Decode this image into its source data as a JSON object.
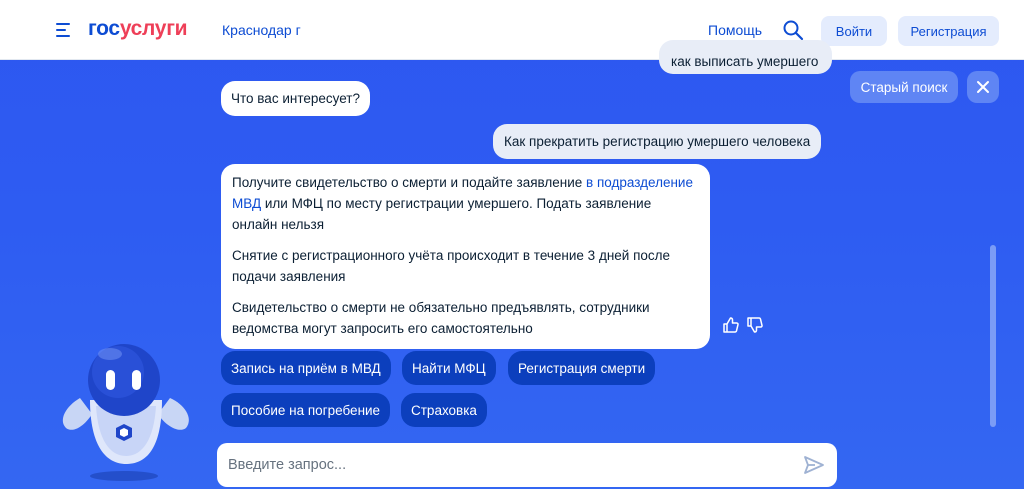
{
  "header": {
    "logo_part1": "гос",
    "logo_part2": "услуги",
    "city": "Краснодар г",
    "help": "Помощь",
    "login": "Войти",
    "register": "Регистрация"
  },
  "chat": {
    "hidden_message": "как выписать умершего",
    "old_search": "Старый поиск",
    "bot_question": "Что вас интересует?",
    "user_message": "Как прекратить регистрацию умершего человека",
    "answer": {
      "p1_before_link": "Получите свидетельство о смерти и подайте заявление ",
      "p1_link": "в подразделение МВД",
      "p1_after_link": " или МФЦ по месту регистрации умершего. Подать заявление онлайн нельзя",
      "p2": "Снятие с регистрационного учёта происходит в течение 3 дней после подачи заявления",
      "p3": "Свидетельство о смерти не обязательно предъявлять, сотрудники ведомства могут запросить его самостоятельно"
    },
    "chips": [
      "Запись на приём в МВД",
      "Найти МФЦ",
      "Регистрация смерти",
      "Пособие на погребение",
      "Страховка"
    ],
    "input_placeholder": "Введите запрос..."
  },
  "colors": {
    "brand_blue": "#0d4cd3",
    "brand_red": "#ee3f58",
    "background": "#2e5cf2",
    "chip": "#0c3fbd"
  },
  "icons": [
    "menu-icon",
    "search-icon",
    "close-icon",
    "thumbs-up-icon",
    "thumbs-down-icon",
    "send-icon",
    "robot-assistant"
  ]
}
